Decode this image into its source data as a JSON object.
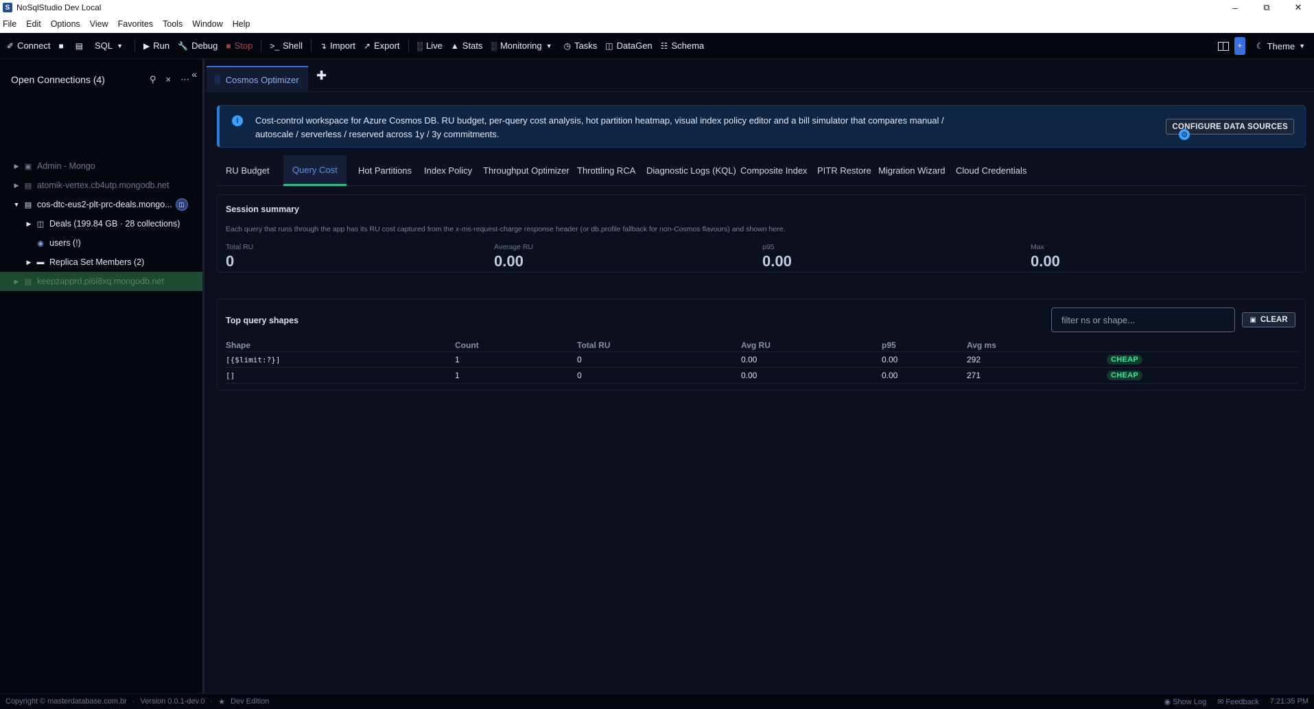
{
  "window": {
    "title": "NoSqlStudio Dev Local",
    "app_icon": "S"
  },
  "menu": [
    "File",
    "Edit",
    "Options",
    "View",
    "Favorites",
    "Tools",
    "Window",
    "Help"
  ],
  "toolbar": {
    "connect": "Connect",
    "sql": "SQL",
    "run": "Run",
    "debug": "Debug",
    "stop": "Stop",
    "shell": "Shell",
    "import": "Import",
    "export": "Export",
    "live": "Live",
    "stats": "Stats",
    "monitoring": "Monitoring",
    "tasks": "Tasks",
    "datagen": "DataGen",
    "schema": "Schema",
    "theme": "Theme",
    "plus": "+"
  },
  "sidebar": {
    "header": "Open Connections (4)",
    "items": [
      {
        "label": "Admin - Mongo"
      },
      {
        "label": "atomik-vertex.cb4utp.mongodb.net"
      },
      {
        "label": "cos-dtc-eus2-plt-prc-deals.mongo..."
      },
      {
        "label": "Deals (199.84 GB · 28 collections)"
      },
      {
        "label": "users (!)"
      },
      {
        "label": "Replica Set Members (2)"
      },
      {
        "label": "keepzapprd.pi6l8xq.mongodb.net"
      }
    ]
  },
  "doc_tab": {
    "label": "Cosmos Optimizer"
  },
  "banner": {
    "text": "Cost-control workspace for Azure Cosmos DB. RU budget, per-query cost analysis, hot partition heatmap, visual index policy editor and a bill simulator that compares manual / autoscale / serverless / reserved across 1y / 3y commitments.",
    "button": "CONFIGURE DATA SOURCES"
  },
  "tabs": [
    "RU Budget",
    "Query Cost",
    "Hot Partitions",
    "Index Policy",
    "Throughput Optimizer",
    "Throttling RCA",
    "Diagnostic Logs (KQL)",
    "Composite Index",
    "PITR Restore",
    "Migration Wizard",
    "Cloud Credentials"
  ],
  "active_tab": "Query Cost",
  "session": {
    "title": "Session summary",
    "desc": "Each query that runs through the app has its RU cost captured from the x-ms-request-charge response header (or db.profile fallback for non-Cosmos flavours) and shown here.",
    "stats": [
      {
        "label": "Total RU",
        "value": "0"
      },
      {
        "label": "Average RU",
        "value": "0.00"
      },
      {
        "label": "p95",
        "value": "0.00"
      },
      {
        "label": "Max",
        "value": "0.00"
      }
    ]
  },
  "shapes": {
    "title": "Top query shapes",
    "filter_placeholder": "filter ns or shape...",
    "clear": "CLEAR",
    "columns": [
      "Shape",
      "Count",
      "Total RU",
      "Avg RU",
      "p95",
      "Avg ms"
    ],
    "rows": [
      {
        "shape": "[{$limit:?}]",
        "count": "1",
        "total_ru": "0",
        "avg_ru": "0.00",
        "p95": "0.00",
        "avg_ms": "292",
        "badge": "CHEAP"
      },
      {
        "shape": "[]",
        "count": "1",
        "total_ru": "0",
        "avg_ru": "0.00",
        "p95": "0.00",
        "avg_ms": "271",
        "badge": "CHEAP"
      }
    ]
  },
  "status": {
    "copyright": "Copyright © masterdatabase.com.br",
    "version": "Version 0.0.1-dev.0",
    "edition": "Dev Edition",
    "show_log": "Show Log",
    "feedback": "Feedback",
    "time": "7:21:35 PM"
  },
  "colors": {
    "accent": "#3b6fe0",
    "success": "#2fbf8a",
    "background": "#0b0f1e",
    "info": "#0f2544"
  }
}
